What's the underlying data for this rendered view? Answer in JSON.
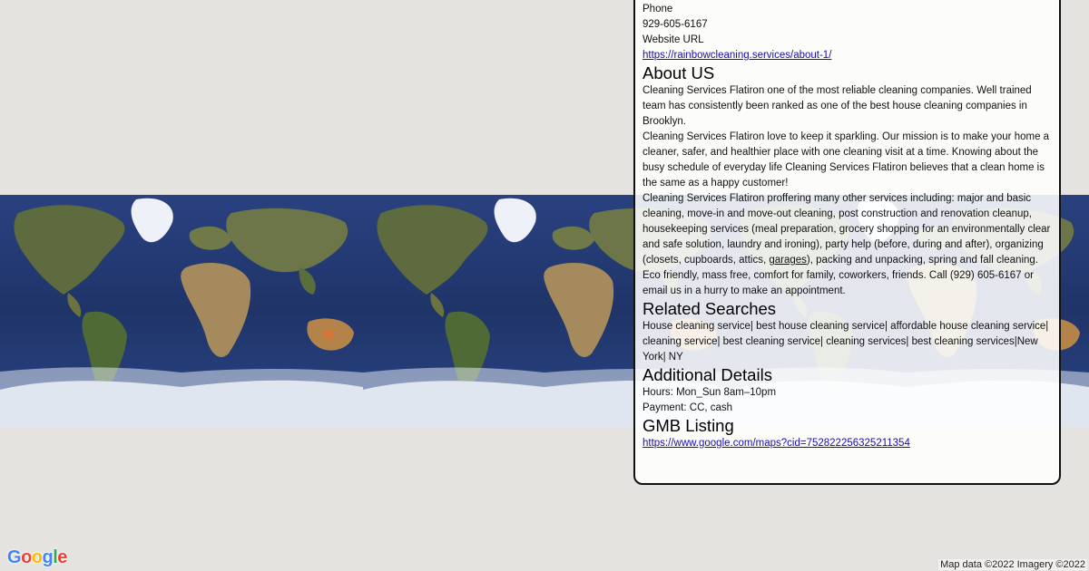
{
  "panel": {
    "phone_label": "Phone",
    "phone_value": "929-605-6167",
    "website_label": "Website URL",
    "website_url": "https://rainbowcleaning.services/about-1/",
    "about": {
      "heading": "About US",
      "para1": "Cleaning Services Flatiron one of the most reliable cleaning companies. Well trained team has consistently been ranked as one of the best house cleaning companies in Brooklyn.",
      "para2": "Cleaning Services Flatiron love to keep it sparkling. Our mission is to make your home a cleaner, safer, and healthier place with one cleaning visit at a time. Knowing about the busy schedule of everyday life Cleaning Services Flatiron believes that a clean home is the same as a happy customer!",
      "para3_before": "Cleaning Services Flatiron proffering many other services including: major and basic cleaning, move-in and move-out cleaning, post construction and renovation cleanup, housekeeping services (meal preparation, grocery shopping for an environmentally clear and safe solution, laundry and ironing), party help (before, during and after), organizing (closets, cupboards, attics, ",
      "para3_link": "garages",
      "para3_after": "), packing and unpacking, spring and fall cleaning. Eco friendly, mass free, comfort for family, coworkers,  friends. Call (929) 605-6167 or email us in a hurry to make an appointment."
    },
    "related": {
      "heading": "Related Searches",
      "text": "House cleaning service| best house cleaning service| affordable house cleaning service| cleaning service| best cleaning service| cleaning services| best cleaning services|New York| NY"
    },
    "details": {
      "heading": "Additional Details",
      "hours": "Hours: Mon_Sun 8am–10pm",
      "payment": "Payment: CC, cash"
    },
    "gmb": {
      "heading": "GMB Listing",
      "url": "https://www.google.com/maps?cid=752822256325211354"
    }
  },
  "map": {
    "logo_letters": [
      "G",
      "o",
      "o",
      "g",
      "l",
      "e"
    ],
    "logo_colors": [
      "#4285f4",
      "#ea4335",
      "#fbbc05",
      "#4285f4",
      "#34a853",
      "#ea4335"
    ],
    "attribution": "Map data ©2022 Imagery ©2022",
    "ocean_color": "#23396f",
    "land_color": "#6f7d4a",
    "ice_color": "#dfe6f0"
  }
}
